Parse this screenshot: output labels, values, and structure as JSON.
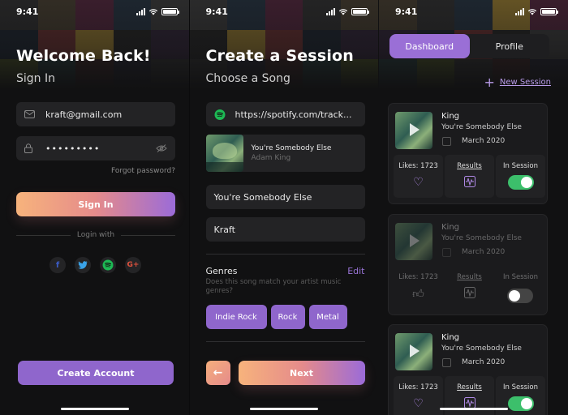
{
  "status_bar": {
    "time": "9:41"
  },
  "login": {
    "title": "Welcome Back!",
    "subtitle": "Sign In",
    "email_value": "kraft@gmail.com",
    "password_value": "•••••••••",
    "forgot_label": "Forgot password?",
    "sign_in_label": "Sign In",
    "divider_label": "Login with",
    "socials": [
      "facebook-icon",
      "twitter-icon",
      "spotify-icon",
      "google-plus-icon"
    ],
    "create_account_label": "Create Account"
  },
  "create_session": {
    "title": "Create a Session",
    "subtitle": "Choose a Song",
    "link_value": "https://spotify.com/track...",
    "song_title": "You're Somebody Else",
    "song_artist": "Adam King",
    "song_field_value": "You're Somebody Else",
    "artist_field_value": "Kraft",
    "genres_heading": "Genres",
    "edit_label": "Edit",
    "genres_description": "Does this song match your artist music genres?",
    "genres": [
      "Indie Rock",
      "Rock",
      "Metal"
    ],
    "back_icon": "←",
    "next_label": "Next"
  },
  "dashboard": {
    "tabs": [
      {
        "label": "Dashboard",
        "active": true
      },
      {
        "label": "Profile",
        "active": false
      }
    ],
    "new_session_label": "New Session",
    "sessions": [
      {
        "name": "King",
        "artist": "You're Somebody Else",
        "date": "March 2020",
        "likes_label": "Likes: 1723",
        "results_label": "Results",
        "in_session_label": "In Session",
        "in_session": true,
        "dimmed": false
      },
      {
        "name": "King",
        "artist": "You're Somebody Else",
        "date": "March 2020",
        "likes_label": "Likes: 1723",
        "results_label": "Results",
        "in_session_label": "In Session",
        "in_session": false,
        "dimmed": true
      },
      {
        "name": "King",
        "artist": "You're Somebody Else",
        "date": "March 2020",
        "likes_label": "Likes: 1723",
        "results_label": "Results",
        "in_session_label": "In Session",
        "in_session": true,
        "dimmed": false
      }
    ]
  },
  "colors": {
    "accent_purple": "#8f66cc",
    "gradient_start": "#f7b37c",
    "gradient_end": "#9b6bd8",
    "toggle_on": "#3cbf6b",
    "background": "#111112"
  }
}
